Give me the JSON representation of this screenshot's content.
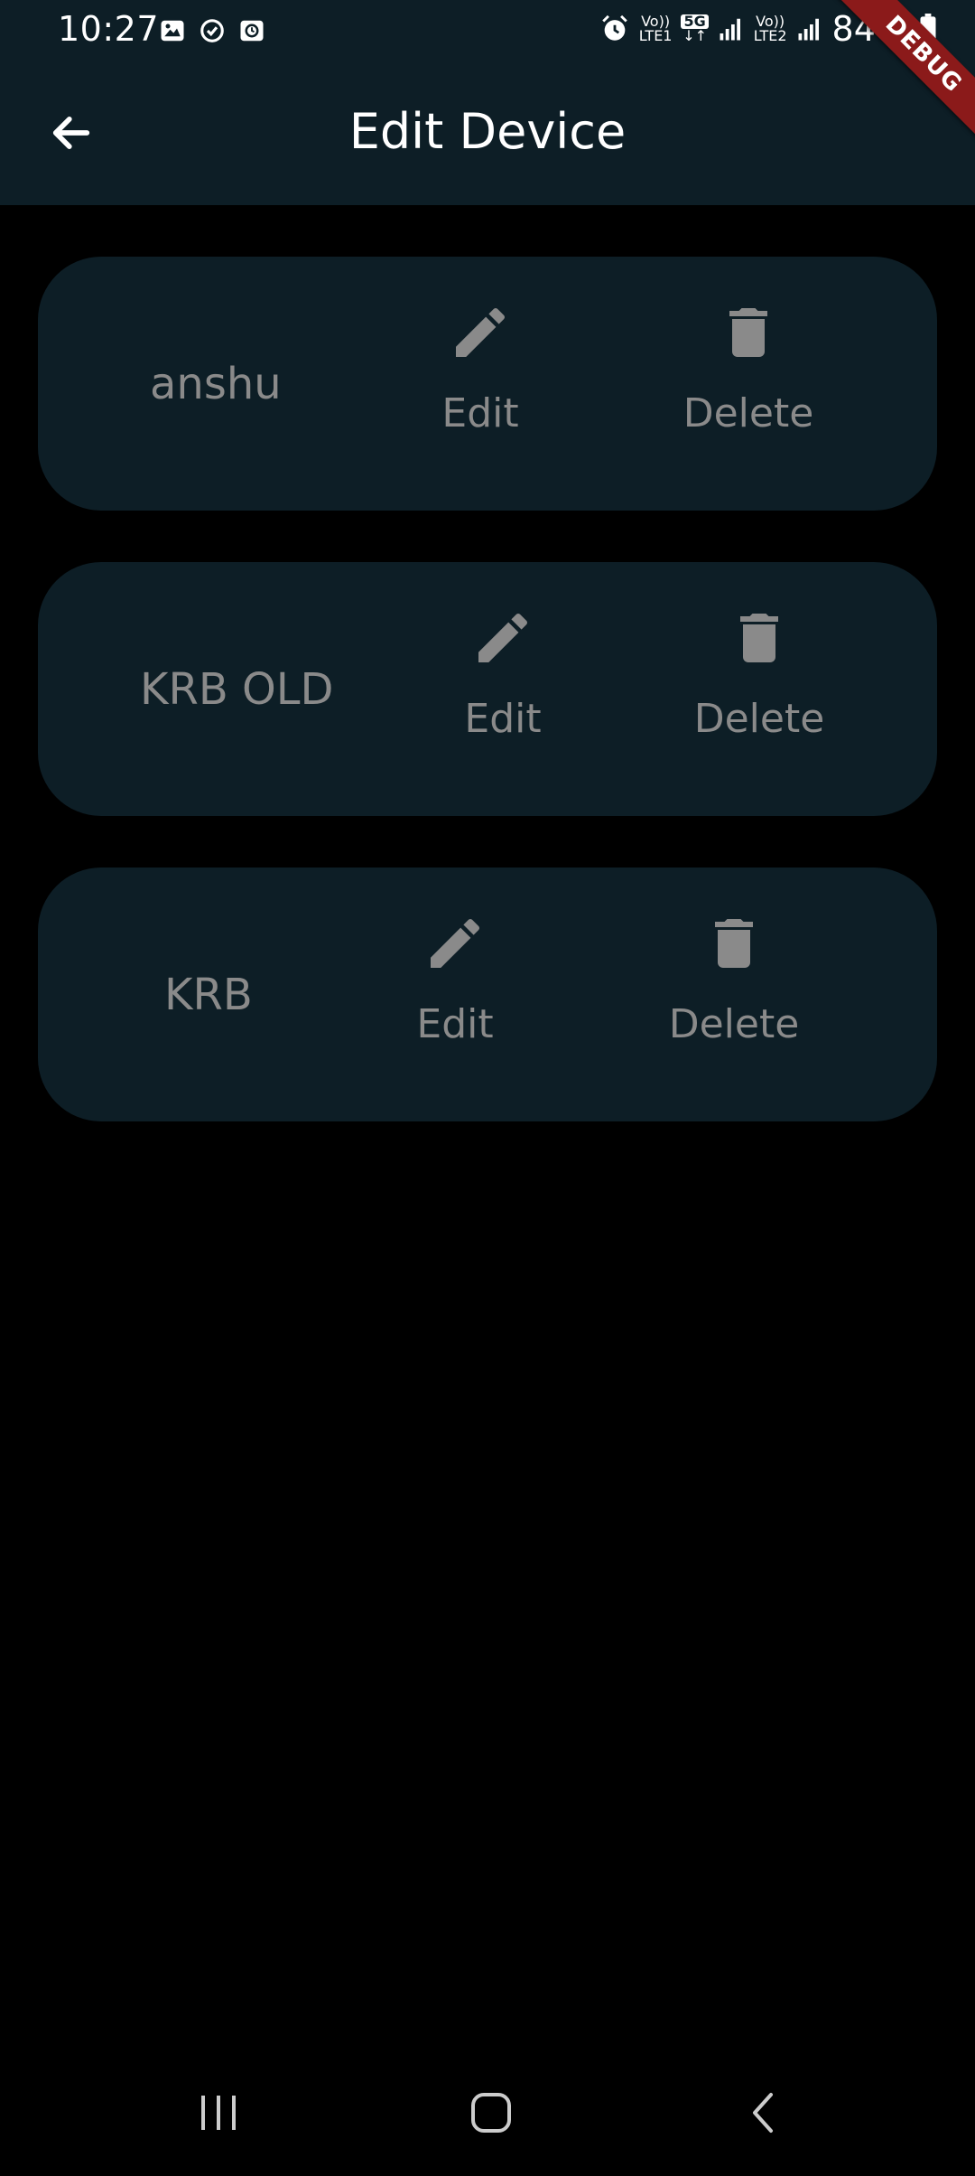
{
  "status_bar": {
    "time": "10:27",
    "battery_percent": "84%",
    "sim1_label_top": "Vo))",
    "sim1_label_bottom": "LTE1",
    "network_badge": "5G",
    "sim2_label_top": "Vo))",
    "sim2_label_bottom": "LTE2",
    "left_icons": [
      "image-icon",
      "sync-icon",
      "clock-app-icon"
    ],
    "right_icons": [
      "alarm-icon",
      "signal-icon",
      "signal-icon",
      "battery-icon"
    ]
  },
  "debug_banner": "DEBUG",
  "app_bar": {
    "title": "Edit Device",
    "back_icon": "arrow-left-icon"
  },
  "devices": [
    {
      "name": "anshu",
      "edit_label": "Edit",
      "delete_label": "Delete"
    },
    {
      "name": "KRB OLD",
      "edit_label": "Edit",
      "delete_label": "Delete"
    },
    {
      "name": "KRB",
      "edit_label": "Edit",
      "delete_label": "Delete"
    }
  ],
  "nav_bar": {
    "items": [
      "recent-apps-icon",
      "home-icon",
      "back-icon"
    ]
  },
  "colors": {
    "background": "#000000",
    "surface": "#0d1e26",
    "muted_text": "#8a8a8a",
    "debug_ribbon": "#8b1a1a"
  }
}
